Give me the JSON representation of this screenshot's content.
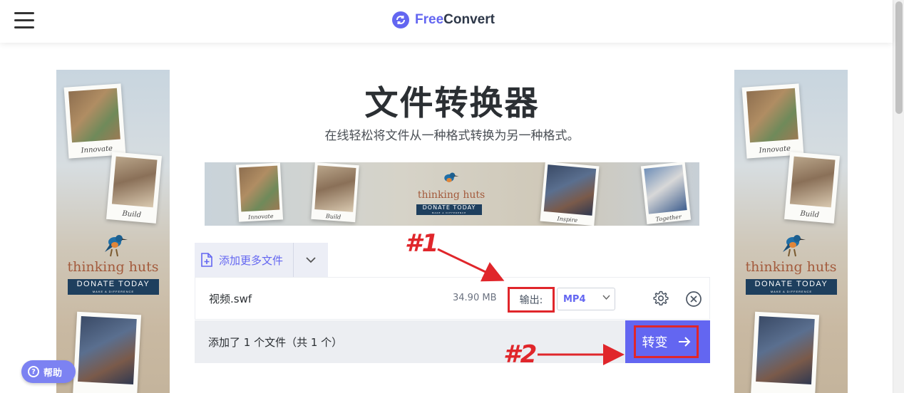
{
  "header": {
    "logo_free": "Free",
    "logo_convert": "Convert",
    "brand_color": "#6366f1"
  },
  "main": {
    "title": "文件转换器",
    "subtitle": "在线轻松将文件从一种格式转换为另一种格式。"
  },
  "ads": {
    "brand": "thinking huts",
    "cta": "DONATE TODAY",
    "cta_sub": "MAKE A DIFFERENCE",
    "captions": [
      "Innovate",
      "Build",
      "Inspire",
      "Together"
    ]
  },
  "uploader": {
    "add_more_label": "添加更多文件",
    "file": {
      "name": "视频.swf",
      "size": "34.90 MB",
      "output_label": "输出:",
      "format": "MP4"
    },
    "status": "添加了 1 个文件（共 1 个）",
    "convert_label": "转变"
  },
  "annotations": {
    "label1": "#1",
    "label2": "#2",
    "color": "#e0262b"
  },
  "help": {
    "label": "帮助"
  }
}
